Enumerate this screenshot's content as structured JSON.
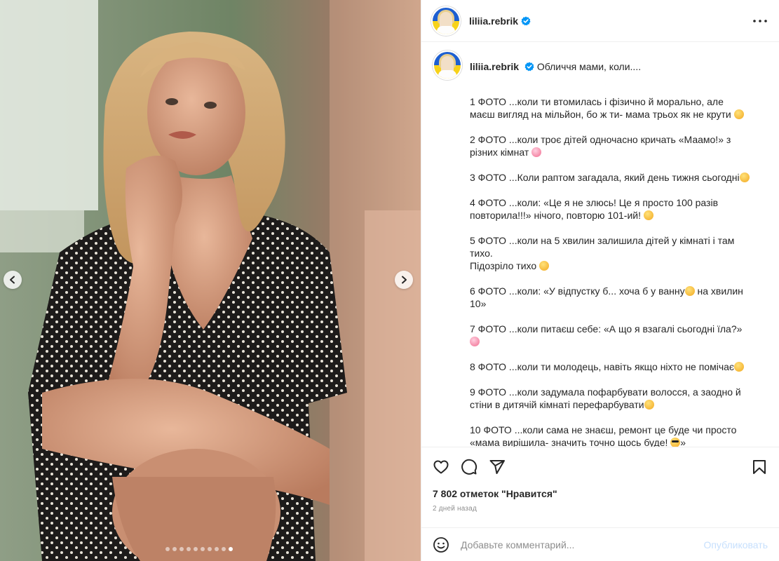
{
  "post": {
    "username": "liliia.rebrik",
    "verified": true,
    "title_text": "Обличчя мами, коли....",
    "caption": [
      {
        "text": "1 ФОТО ...коли ти втомилась і фізично й морально, але маєш вигляд на мільйон, бо ж ти- мама трьох як не крути",
        "emoji": "grinning-sweat-emoji"
      },
      {
        "text": "2 ФОТО ...коли троє дітей одночасно кричать «Маамо!» з різних кімнат",
        "emoji": "woozy-face-emoji"
      },
      {
        "text": "3 ФОТО ...Коли раптом загадала, який день тижня сьогодні",
        "emoji": "exploding-head-emoji"
      },
      {
        "text": "4 ФОТО ...коли: «Це я не злюсь! Це я просто 100 разів повторила!!!» нічого, повторю 101-ий!",
        "emoji": "rolling-eyes-emoji"
      },
      {
        "text": "5 ФОТО ...коли на 5 хвилин залишила дітей у кімнаті і там тихо.",
        "text2": "Підозріло тихо",
        "emoji": "face-with-tongue-emoji"
      },
      {
        "text": "6 ФОТО ...коли: «У відпустку б... хоча б у ванну",
        "text_after": " на хвилин 10»",
        "emoji": "zany-face-emoji"
      },
      {
        "text": "7 ФОТО ...коли питаєш себе: «А що я взагалі сьогодні їла?»",
        "emoji": "flushed-face-emoji"
      },
      {
        "text": "8 ФОТО ...коли ти молодець, навіть якщо ніхто не помічає",
        "emoji": "halo-face-emoji"
      },
      {
        "text": "9 ФОТО ...коли задумала пофарбувати волосся, а заодно й стіни в дитячій кімнаті перефарбувати",
        "emoji": "sweat-smile-emoji"
      },
      {
        "text": "10 ФОТО ...коли сама не знаєш, ремонт це буде чи просто «мама вирішила- значить точно щось буде!",
        "emoji": "sunglasses-emoji"
      }
    ]
  },
  "media": {
    "carousel_total": 10,
    "carousel_active_index": 9,
    "prev_icon": "chevron-left-icon",
    "next_icon": "chevron-right-icon"
  },
  "actions": {
    "likes_text": "7 802 отметок \"Нравится\"",
    "time_text": "2 дней назад",
    "icons": [
      "heart-icon",
      "comment-icon",
      "share-icon",
      "bookmark-icon"
    ]
  },
  "comment_box": {
    "placeholder": "Добавьте комментарий...",
    "publish_label": "Опубликовать"
  },
  "colors": {
    "text": "#262626",
    "muted": "#8e8e8e",
    "verified_blue": "#0095f6",
    "publish_disabled": "#c7e0fd",
    "divider": "#efefef"
  }
}
